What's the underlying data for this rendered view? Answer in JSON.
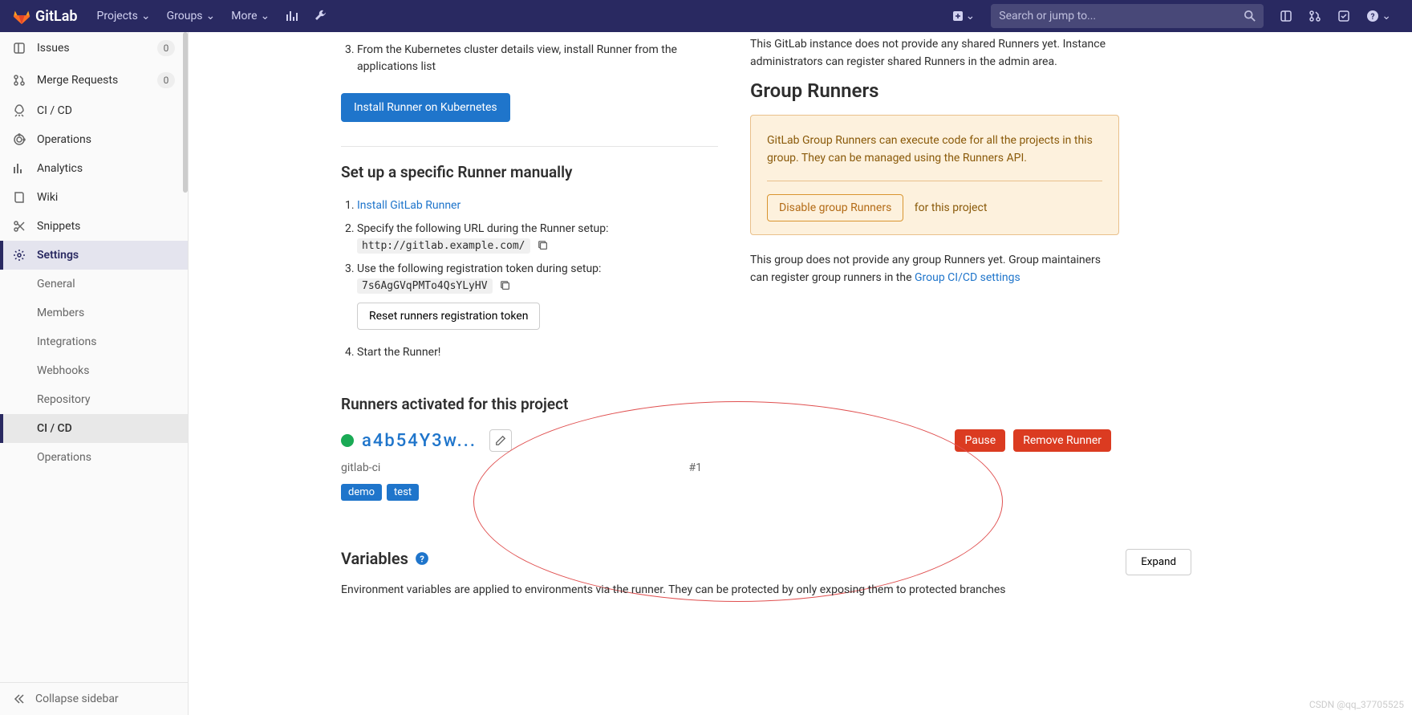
{
  "topnav": {
    "brand": "GitLab",
    "items": [
      "Projects",
      "Groups",
      "More"
    ],
    "search_ph": "Search or jump to..."
  },
  "sidebar": {
    "items": [
      {
        "label": "Issues",
        "badge": "0"
      },
      {
        "label": "Merge Requests",
        "badge": "0"
      },
      {
        "label": "CI / CD"
      },
      {
        "label": "Operations"
      },
      {
        "label": "Analytics"
      },
      {
        "label": "Wiki"
      },
      {
        "label": "Snippets"
      },
      {
        "label": "Settings"
      }
    ],
    "sub": [
      "General",
      "Members",
      "Integrations",
      "Webhooks",
      "Repository",
      "CI / CD",
      "Operations"
    ],
    "collapse": "Collapse sidebar"
  },
  "k8s": {
    "step3": "From the Kubernetes cluster details view, install Runner from the applications list",
    "btn": "Install Runner on Kubernetes"
  },
  "specific": {
    "heading": "Set up a specific Runner manually",
    "step1_pre": "",
    "step1_link": "Install GitLab Runner",
    "step2": "Specify the following URL during the Runner setup:",
    "url": "http://gitlab.example.com/",
    "step3": "Use the following registration token during setup:",
    "token": "7s6AgGVqPMTo4QsYLyHV",
    "reset_btn": "Reset runners registration token",
    "step4": "Start the Runner!"
  },
  "shared": {
    "p1": "This GitLab instance does not provide any shared Runners yet. Instance administrators can register shared Runners in the admin area."
  },
  "group": {
    "heading": "Group Runners",
    "box": "GitLab Group Runners can execute code for all the projects in this group. They can be managed using the Runners API.",
    "disable_btn": "Disable group Runners",
    "for_proj": "for this project",
    "p2a": "This group does not provide any group Runners yet. Group maintainers can register group runners in the ",
    "p2link": "Group CI/CD settings"
  },
  "activated": {
    "heading": "Runners activated for this project",
    "id": "a4b54Y3w...",
    "pause": "Pause",
    "remove": "Remove Runner",
    "name": "gitlab-ci",
    "num": "#1",
    "tags": [
      "demo",
      "test"
    ]
  },
  "vars": {
    "heading": "Variables",
    "expand": "Expand",
    "desc": "Environment variables are applied to environments via the runner. They can be protected by only exposing them to protected branches"
  },
  "watermark": "CSDN @qq_37705525"
}
